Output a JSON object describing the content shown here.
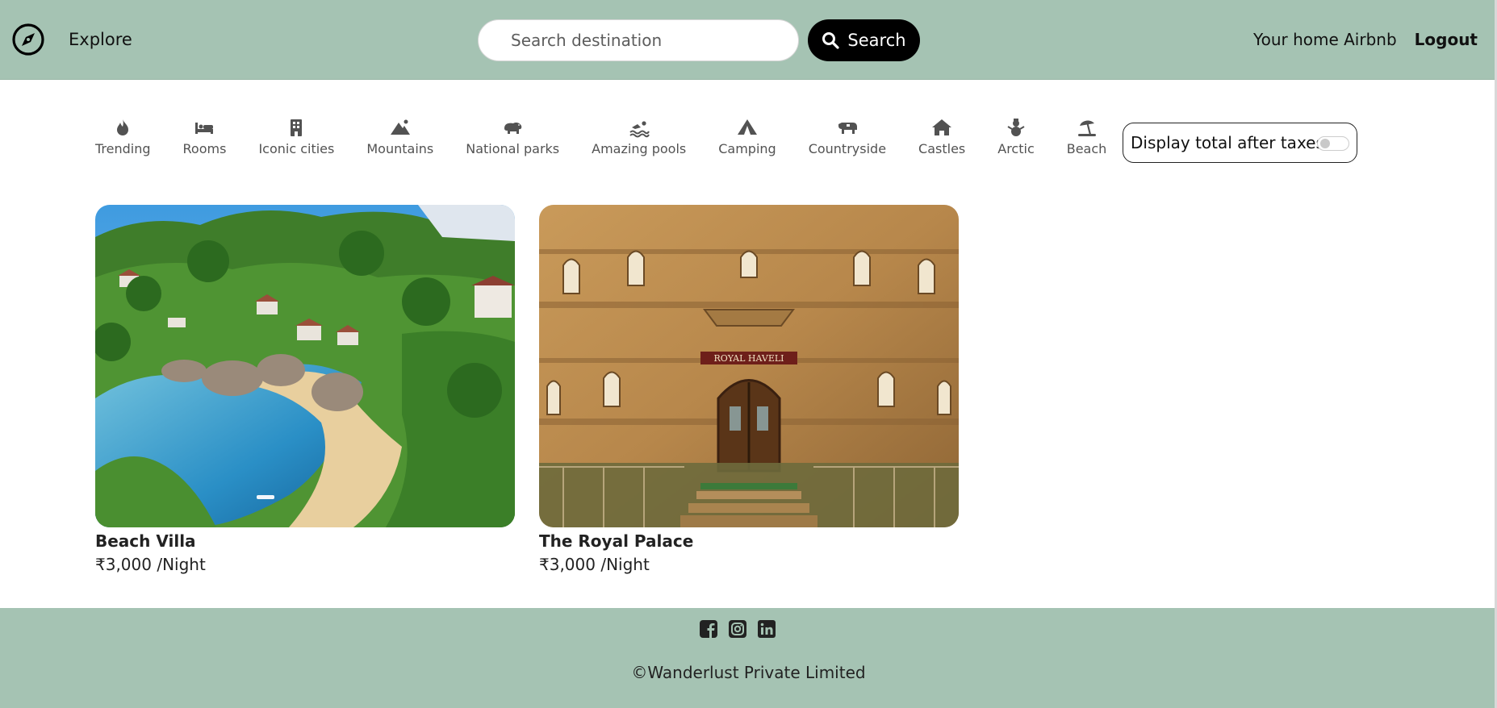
{
  "navbar": {
    "brand_icon": "compass-icon",
    "explore_label": "Explore",
    "search_placeholder": "Search destination",
    "search_label": "Search",
    "host_label": "Your home Airbnb",
    "logout_label": "Logout",
    "background": "#a5c3b3"
  },
  "filters": [
    {
      "icon": "fire-icon",
      "label": "Trending"
    },
    {
      "icon": "bed-icon",
      "label": "Rooms"
    },
    {
      "icon": "building-icon",
      "label": "Iconic cities"
    },
    {
      "icon": "mountain-icon",
      "label": "Mountains"
    },
    {
      "icon": "hippo-icon",
      "label": "National parks"
    },
    {
      "icon": "swimmer-icon",
      "label": "Amazing pools"
    },
    {
      "icon": "tent-icon",
      "label": "Camping"
    },
    {
      "icon": "cow-icon",
      "label": "Countryside"
    },
    {
      "icon": "house-icon",
      "label": "Castles"
    },
    {
      "icon": "snowman-icon",
      "label": "Arctic"
    },
    {
      "icon": "umbrella-beach-icon",
      "label": "Beach"
    }
  ],
  "tax_toggle": {
    "label": "Display total after taxes",
    "enabled": false
  },
  "listings": [
    {
      "title": "Beach Villa",
      "price": "₹3,000 /Night",
      "image": "tropical-beach-villa-photo"
    },
    {
      "title": "The Royal Palace",
      "price": "₹3,000 /Night",
      "image": "sandstone-haveli-photo",
      "sign_text": "ROYAL HAVELI"
    }
  ],
  "footer": {
    "social_icons": [
      "facebook-icon",
      "instagram-icon",
      "linkedin-icon"
    ],
    "copyright": "©Wanderlust Private Limited",
    "background": "#a5c3b3"
  }
}
